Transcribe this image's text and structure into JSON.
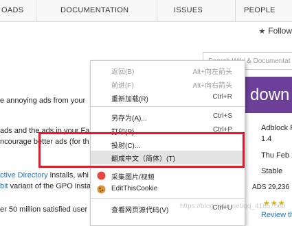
{
  "nav": {
    "items": [
      "OADS",
      "DOCUMENTATION",
      "ISSUES",
      "PEOPLE"
    ]
  },
  "follow_label": "Follow",
  "search_placeholder": "Search Wiki & Documentat",
  "banner_text": "down",
  "body_lines": [
    {
      "text": "e annoying ads from your"
    },
    {
      "text": "ads and the ads in your Fa"
    },
    {
      "text": "ncourage better ads (for th"
    },
    {
      "link": "ctive Directory",
      "text": " installs, whi"
    },
    {
      "link": "bit",
      "text": " variant of the GPO insta"
    },
    {
      "text": "er 50 million satisfied user"
    }
  ],
  "info": {
    "name": "Adblock P",
    "version": "1.4",
    "date": "Thu Feb 2",
    "channel": "Stable",
    "downloads": "ADS 29,236",
    "review": "Review th"
  },
  "context_menu": {
    "items": [
      {
        "label": "返回(B)",
        "shortcut": "Alt+向左箭头",
        "disabled": true
      },
      {
        "label": "前进(F)",
        "shortcut": "Alt+向右箭头",
        "disabled": true
      },
      {
        "label": "重新加载(R)",
        "shortcut": "Ctrl+R",
        "disabled": false
      },
      {
        "label": "另存为(A)...",
        "shortcut": "Ctrl+S",
        "disabled": false
      },
      {
        "label": "打印(P)...",
        "shortcut": "Ctrl+P",
        "disabled": false
      },
      {
        "label": "投射(C)...",
        "shortcut": "",
        "disabled": false
      },
      {
        "label": "翻成中文（简体）(T)",
        "shortcut": "",
        "disabled": false,
        "hovered": true
      },
      {
        "label": "采集图片/视频",
        "shortcut": "",
        "disabled": false,
        "icon": "red-circle-extension-icon"
      },
      {
        "label": "EditThisCookie",
        "shortcut": "",
        "disabled": false,
        "icon": "cookie-icon"
      },
      {
        "label": "查看网页源代码(V)",
        "shortcut": "Ctrl+U",
        "disabled": false
      }
    ]
  },
  "watermark": "https://blog.csdn.net/qq_41867660",
  "colors": {
    "highlight": "#e6172a",
    "banner": "#6c3f99",
    "link": "#1a73c8"
  }
}
